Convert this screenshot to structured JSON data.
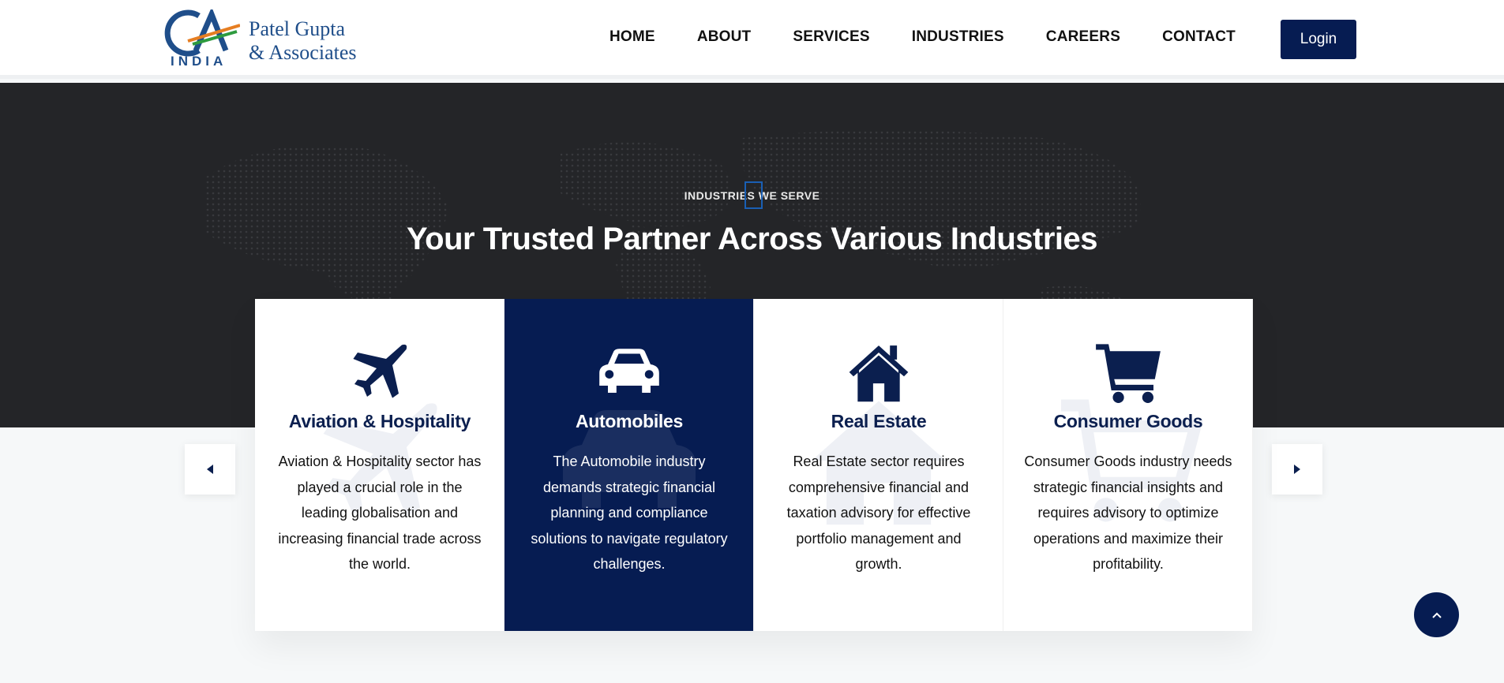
{
  "header": {
    "logo": {
      "line1": "Patel Gupta",
      "line2": "& Associates",
      "country": "INDIA",
      "mark": "CA"
    },
    "nav": [
      "HOME",
      "ABOUT",
      "SERVICES",
      "INDUSTRIES",
      "CAREERS",
      "CONTACT"
    ],
    "login_label": "Login"
  },
  "hero": {
    "eyebrow": "INDUSTRIES WE SERVE",
    "title": "Your Trusted Partner Across Various Industries"
  },
  "industries": [
    {
      "icon": "plane-icon",
      "title": "Aviation & Hospitality",
      "text": "Aviation & Hospitality sector has played a crucial role in the leading globalisation and increasing financial trade across the world.",
      "active": false
    },
    {
      "icon": "car-icon",
      "title": "Automobiles",
      "text": "The Automobile industry demands strategic financial planning and compliance solutions to navigate regulatory challenges.",
      "active": true
    },
    {
      "icon": "house-icon",
      "title": "Real Estate",
      "text": "Real Estate sector requires comprehensive financial and taxation advisory for effective portfolio management and growth.",
      "active": false
    },
    {
      "icon": "cart-icon",
      "title": "Consumer Goods",
      "text": "Consumer Goods industry needs strategic financial insights and requires advisory to optimize operations and maximize their profitability.",
      "active": false
    }
  ],
  "carousel": {
    "prev_icon": "caret-left-icon",
    "next_icon": "caret-right-icon"
  },
  "scroll_top_icon": "chevron-up-icon",
  "colors": {
    "brand_navy": "#061c52",
    "hero_bg": "#242528",
    "page_bg": "#f6f8f9"
  }
}
